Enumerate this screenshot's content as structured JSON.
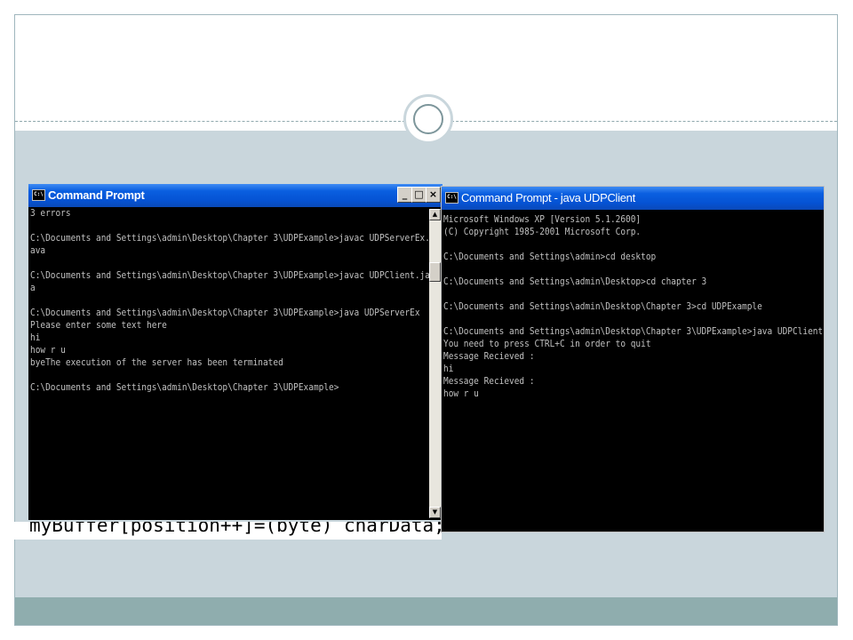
{
  "left_window": {
    "title": "Command Prompt",
    "title_icon": "console-icon",
    "buttons": {
      "minimize": "_",
      "maximize": "□",
      "close": "×"
    },
    "lines": [
      "3 errors",
      "",
      "C:\\Documents and Settings\\admin\\Desktop\\Chapter 3\\UDPExample>javac UDPServerEx.j",
      "ava",
      "",
      "C:\\Documents and Settings\\admin\\Desktop\\Chapter 3\\UDPExample>javac UDPClient.jav",
      "a",
      "",
      "C:\\Documents and Settings\\admin\\Desktop\\Chapter 3\\UDPExample>java UDPServerEx",
      "Please enter some text here",
      "hi",
      "how r u",
      "byeThe execution of the server has been terminated",
      "",
      "C:\\Documents and Settings\\admin\\Desktop\\Chapter 3\\UDPExample>"
    ]
  },
  "right_window": {
    "title": "Command Prompt - java UDPClient",
    "title_icon": "console-icon",
    "lines": [
      "Microsoft Windows XP [Version 5.1.2600]",
      "(C) Copyright 1985-2001 Microsoft Corp.",
      "",
      "C:\\Documents and Settings\\admin>cd desktop",
      "",
      "C:\\Documents and Settings\\admin\\Desktop>cd chapter 3",
      "",
      "C:\\Documents and Settings\\admin\\Desktop\\Chapter 3>cd UDPExample",
      "",
      "C:\\Documents and Settings\\admin\\Desktop\\Chapter 3\\UDPExample>java UDPClient",
      "You need to press CTRL+C in order to quit",
      "Message Recieved :",
      "hi",
      "Message Recieved :",
      "how r u"
    ]
  },
  "code_fragment": "myBuffer[position++]=(byte) charData;",
  "colors": {
    "titlebar": "#0553d4",
    "console_bg": "#000000",
    "console_text": "#c0c0c0",
    "slide_band": "#c9d6dc",
    "slide_footer": "#8fadae"
  }
}
